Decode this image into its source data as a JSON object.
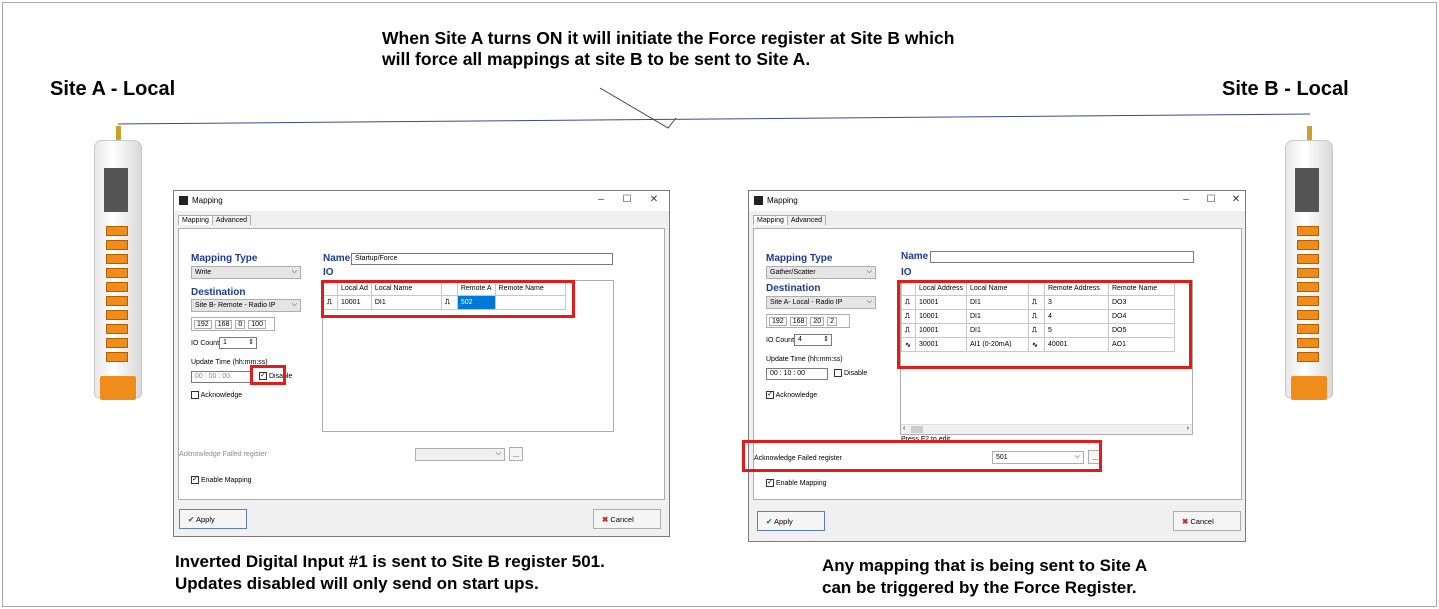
{
  "top_note_line1": "When Site A turns ON it will initiate the Force register at Site B which",
  "top_note_line2": "will force all mappings at site B to be sent to Site A.",
  "site_a_label": "Site A - Local",
  "site_b_label": "Site B - Local",
  "caption_left_line1": "Inverted Digital Input #1 is sent to Site B register 501.",
  "caption_left_line2": "Updates disabled will only send on start ups.",
  "caption_right_line1": "Any mapping that is being sent to Site A",
  "caption_right_line2": "can be triggered by the Force Register.",
  "colors": {
    "highlight_red": "#e21b1b",
    "heading_blue": "#1f3a93",
    "device_orange": "#f08c1a"
  },
  "dialog_left": {
    "title": "Mapping",
    "tabs": [
      "Mapping",
      "Advanced"
    ],
    "mapping_type_label": "Mapping Type",
    "mapping_type_value": "Write",
    "destination_label": "Destination",
    "destination_value": "Site B- Remote - Radio IP",
    "ip": [
      "192",
      "168",
      "0",
      "100"
    ],
    "io_count_label": "IO Count",
    "io_count_value": "1",
    "update_time_label": "Update Time  (hh:mm:ss)",
    "time": [
      "00",
      "00",
      "00"
    ],
    "disable_label": "Disable",
    "acknowledge_label": "Acknowledge",
    "name_label": "Name",
    "name_value": "Startup/Force",
    "io_label": "IO",
    "columns": [
      "Local Ad",
      "Local Name",
      "",
      "Remote A",
      "Remote Name"
    ],
    "rows": [
      {
        "local_addr": "10001",
        "local_name": "DI1",
        "remote_addr": "502",
        "remote_name": ""
      }
    ],
    "ack_failed_label": "Acknowledge Failed register",
    "ack_failed_value": "",
    "ellipsis": "...",
    "enable_mapping_label": "Enable Mapping",
    "apply_label": "Apply",
    "cancel_label": "Cancel"
  },
  "dialog_right": {
    "title": "Mapping",
    "tabs": [
      "Mapping",
      "Advanced"
    ],
    "mapping_type_label": "Mapping Type",
    "mapping_type_value": "Gather/Scatter",
    "destination_label": "Destination",
    "destination_value": "Site A- Local - Radio IP",
    "ip": [
      "192",
      "168",
      "20",
      "2"
    ],
    "io_count_label": "IO Count",
    "io_count_value": "4",
    "update_time_label": "Update Time  (hh:mm:ss)",
    "time": [
      "00",
      "10",
      "00"
    ],
    "disable_label": "Disable",
    "acknowledge_label": "Acknowledge",
    "name_label": "Name",
    "name_value": "",
    "io_label": "IO",
    "columns": [
      "Local Address",
      "Local Name",
      "",
      "Remote Address",
      "Remote Name"
    ],
    "rows": [
      {
        "local_addr": "10001",
        "local_name": "DI1",
        "remote_addr": "3",
        "remote_name": "DO3",
        "icon": "digital-pulse-icon"
      },
      {
        "local_addr": "10001",
        "local_name": "DI1",
        "remote_addr": "4",
        "remote_name": "DO4",
        "icon": "digital-pulse-icon"
      },
      {
        "local_addr": "10001",
        "local_name": "DI1",
        "remote_addr": "5",
        "remote_name": "DO5",
        "icon": "digital-pulse-icon"
      },
      {
        "local_addr": "30001",
        "local_name": "AI1 (0-20mA)",
        "remote_addr": "40001",
        "remote_name": "AO1",
        "icon": "analog-wave-icon"
      }
    ],
    "press_f2": "Press F2 to edit",
    "ack_failed_label": "Acknowledge Failed register",
    "ack_failed_value": "501",
    "ellipsis": "...",
    "enable_mapping_label": "Enable Mapping",
    "apply_label": "Apply",
    "cancel_label": "Cancel"
  }
}
